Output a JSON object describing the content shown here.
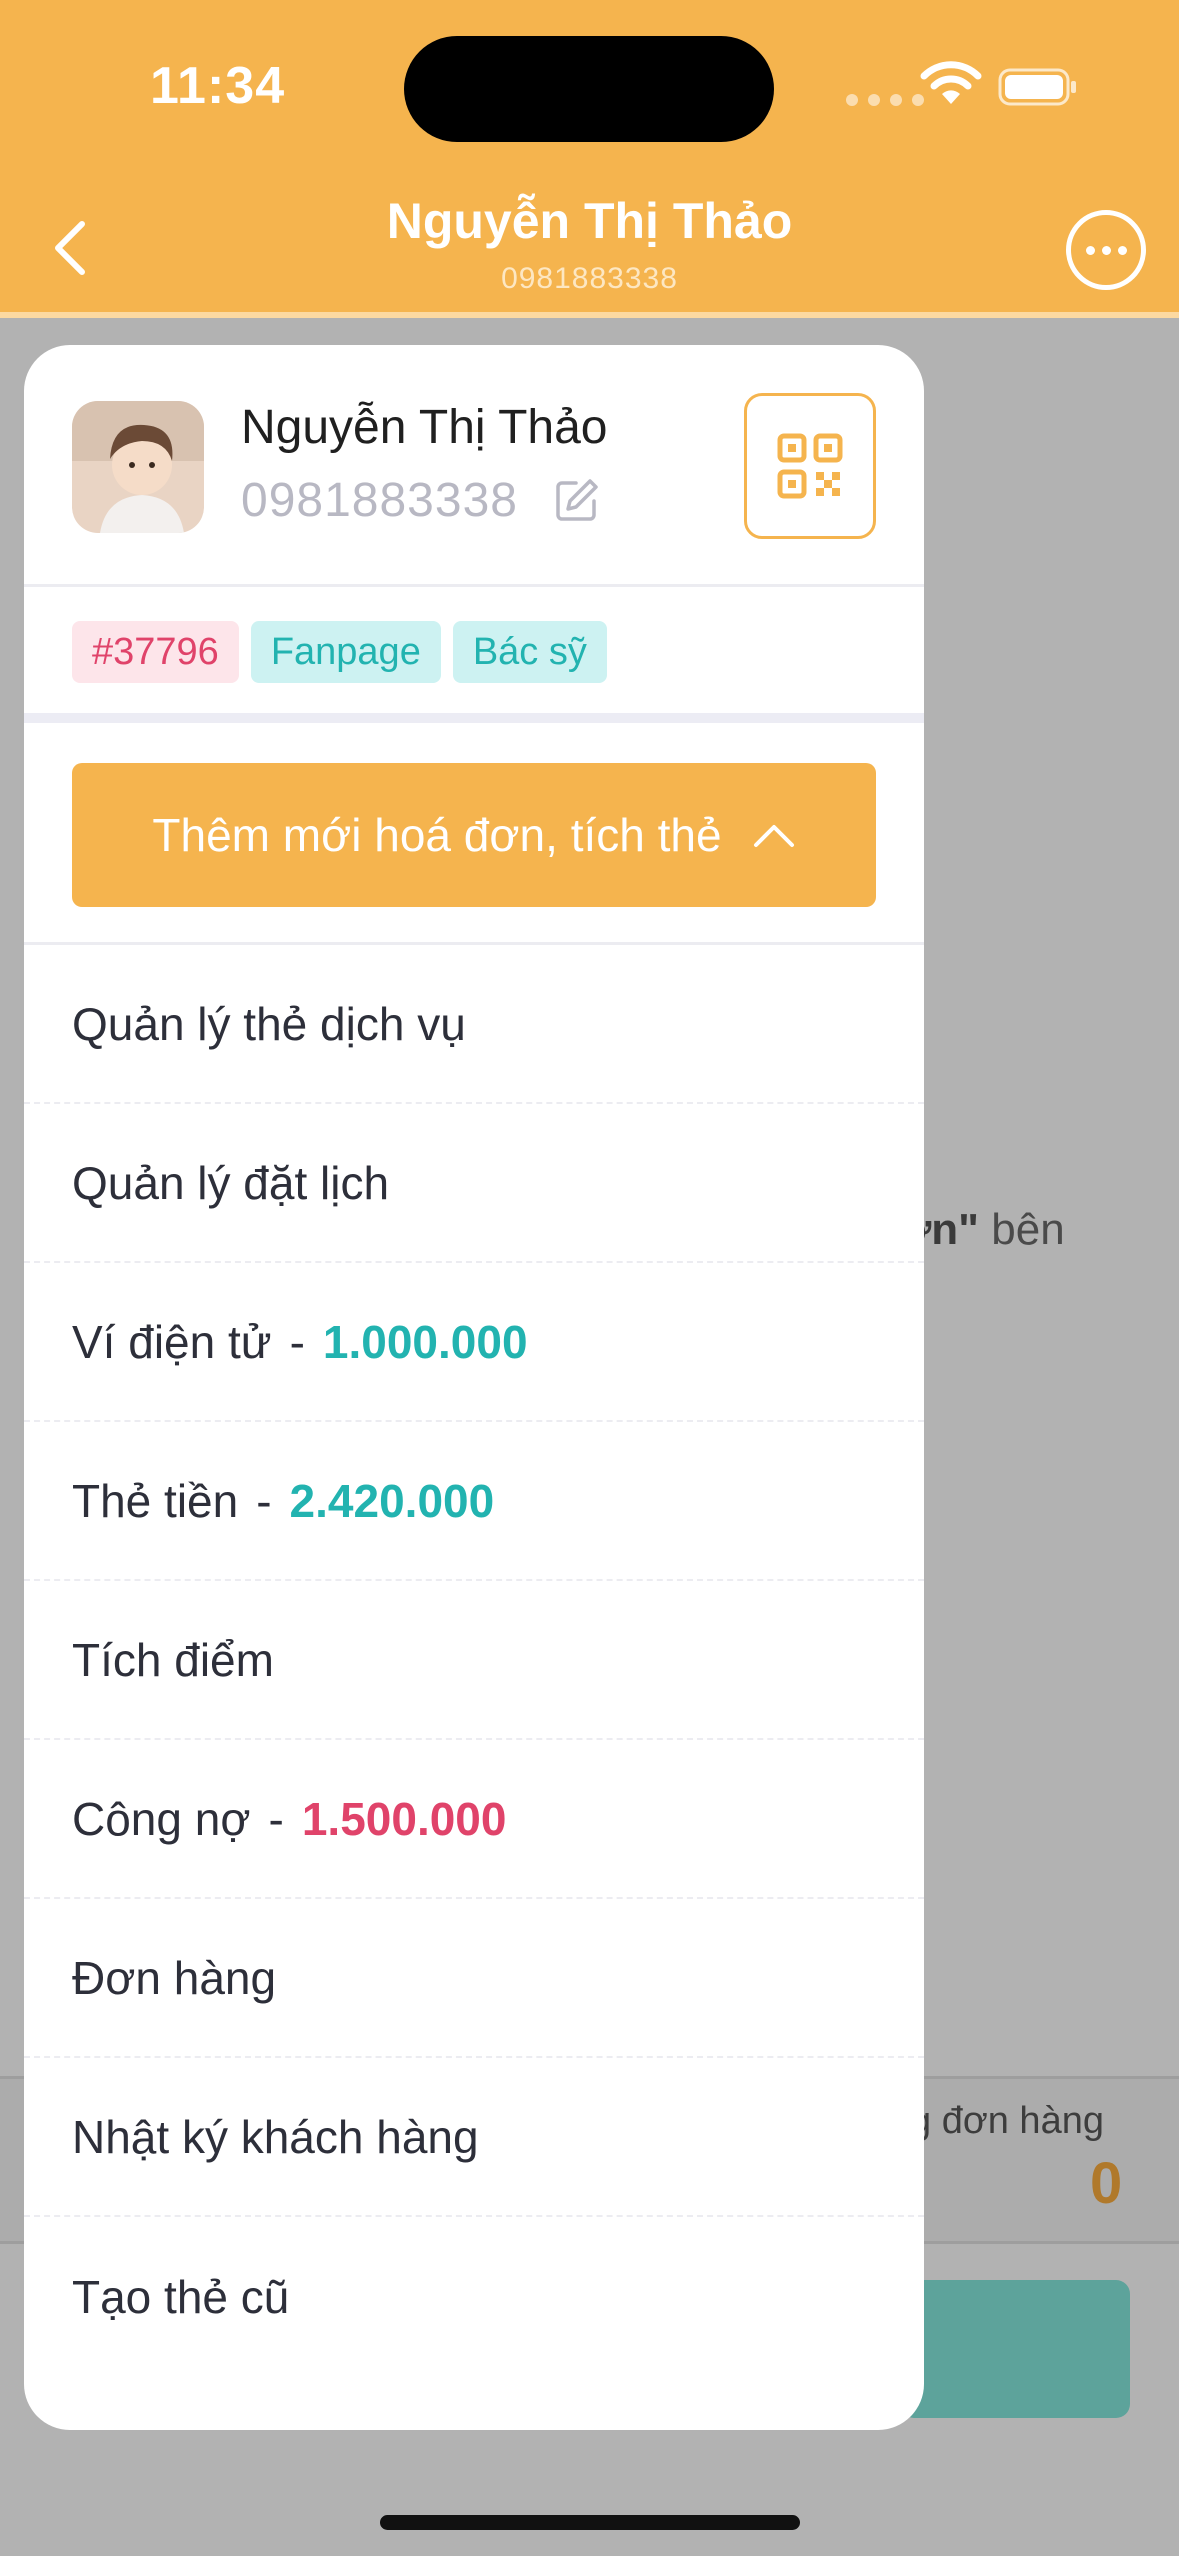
{
  "status_bar": {
    "time": "11:34"
  },
  "header": {
    "title": "Nguyễn Thị Thảo",
    "subtitle": "0981883338"
  },
  "background": {
    "hint_bold": "ơn\"",
    "hint_rest": " bên",
    "footer_label": "g đơn hàng",
    "footer_count": "0"
  },
  "profile": {
    "name": "Nguyễn Thị Thảo",
    "phone": "0981883338"
  },
  "tags": [
    {
      "label": "#37796"
    },
    {
      "label": "Fanpage"
    },
    {
      "label": "Bác sỹ"
    }
  ],
  "add_button": {
    "label": "Thêm mới hoá đơn, tích thẻ"
  },
  "menu": {
    "items": [
      {
        "label": "Quản lý thẻ dịch vụ"
      },
      {
        "label": "Quản lý đặt lịch"
      },
      {
        "label": "Ví điện tử",
        "sep": "-",
        "value": "1.000.000"
      },
      {
        "label": "Thẻ tiền",
        "sep": "-",
        "value": "2.420.000"
      },
      {
        "label": "Tích điểm"
      },
      {
        "label": "Công nợ",
        "sep": "-",
        "value": "1.500.000"
      },
      {
        "label": "Đơn hàng"
      },
      {
        "label": "Nhật ký khách hàng"
      },
      {
        "label": "Tạo thẻ cũ"
      }
    ]
  },
  "colors": {
    "brand": "#f5b44e",
    "teal": "#22b3b0",
    "red": "#e0436a"
  },
  "icons": [
    "chevron-left-icon",
    "more-icon",
    "qr-code-icon",
    "edit-icon",
    "chevron-up-icon",
    "wifi-icon",
    "battery-icon"
  ]
}
